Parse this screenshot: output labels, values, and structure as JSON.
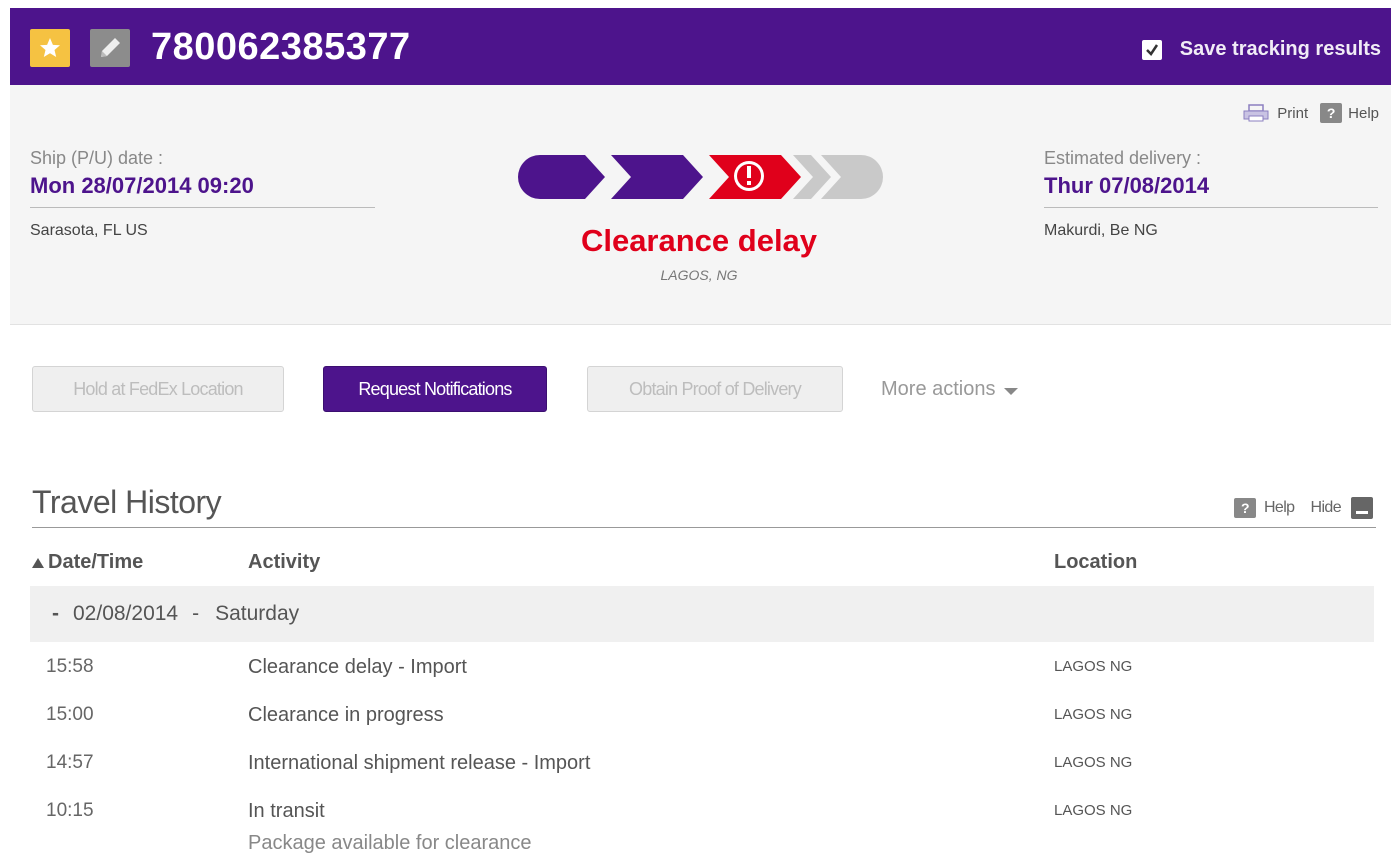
{
  "header": {
    "tracking_number": "780062385377",
    "save_label": "Save tracking results",
    "save_checked": true,
    "star_icon": "star-icon",
    "edit_icon": "pencil-icon",
    "brand_color": "#4d148c"
  },
  "summary": {
    "print_label": "Print",
    "help_label": "Help",
    "ship_label": "Ship (P/U) date :",
    "ship_date": "Mon 28/07/2014 09:20",
    "origin": "Sarasota, FL  US",
    "delivery_label": "Estimated delivery :",
    "delivery_date": "Thur 07/08/2014",
    "destination": "Makurdi, Be  NG",
    "status": "Clearance delay",
    "status_location": "LAGOS, NG",
    "status_color": "#e0001b",
    "progress_steps_completed": 3,
    "progress_steps_total": 5
  },
  "actions": {
    "hold": "Hold at FedEx Location",
    "request": "Request Notifications",
    "pod": "Obtain Proof of Delivery",
    "more": "More actions"
  },
  "history": {
    "title": "Travel History",
    "help_label": "Help",
    "hide_label": "Hide",
    "columns": {
      "date": "Date/Time",
      "activity": "Activity",
      "location": "Location"
    },
    "day": {
      "toggle": "-",
      "date": "02/08/2014",
      "sep": "-",
      "weekday": "Saturday"
    },
    "events": [
      {
        "time": "15:58",
        "activity": "Clearance delay - Import",
        "detail": "",
        "location": "LAGOS NG"
      },
      {
        "time": "15:00",
        "activity": "Clearance in progress",
        "detail": "",
        "location": "LAGOS NG"
      },
      {
        "time": "14:57",
        "activity": "International shipment release - Import",
        "detail": "",
        "location": "LAGOS NG"
      },
      {
        "time": "10:15",
        "activity": "In transit",
        "detail": "Package available for clearance",
        "location": "LAGOS NG"
      }
    ]
  }
}
